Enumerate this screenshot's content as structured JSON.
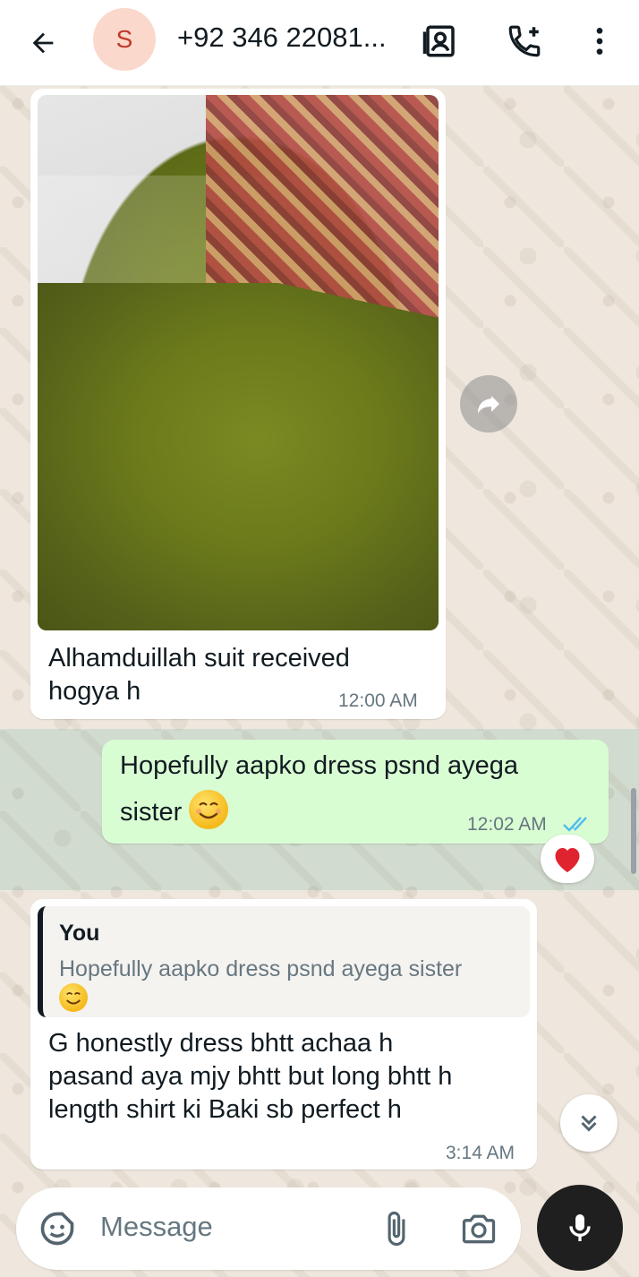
{
  "header": {
    "avatar_letter": "S",
    "contact_name": "+92 346 22081...",
    "icons": [
      "back-arrow-icon",
      "contact-card-icon",
      "add-call-icon",
      "more-vert-icon"
    ]
  },
  "messages": [
    {
      "direction": "in",
      "has_photo": true,
      "text": "Alhamduillah suit received hogya h",
      "line1": "Alhamduillah suit received",
      "line2": "hogya h",
      "time": "12:00 AM"
    },
    {
      "direction": "out",
      "line1": "Hopefully aapko dress psnd ayega",
      "line2": "sister",
      "emoji": "😊",
      "time": "12:02 AM",
      "status": "read",
      "reaction": "❤️"
    },
    {
      "direction": "in",
      "quote_author": "You",
      "quote_text": "Hopefully aapko dress psnd ayega sister",
      "quote_emoji": "😊",
      "line1": "G honestly dress bhtt achaa h",
      "line2": "pasand aya mjy bhtt but long bhtt h",
      "line3": "length shirt ki Baki sb perfect h",
      "time": "3:14 AM"
    }
  ],
  "input": {
    "placeholder": "Message",
    "icons": [
      "sticker-icon",
      "attach-icon",
      "camera-icon",
      "mic-icon"
    ]
  },
  "colors": {
    "outgoing_bubble": "#d9fdd3",
    "incoming_bubble": "#ffffff",
    "read_ticks": "#53bdeb",
    "avatar_bg": "#fbd8cc",
    "mic_button": "#1f1f1f"
  }
}
